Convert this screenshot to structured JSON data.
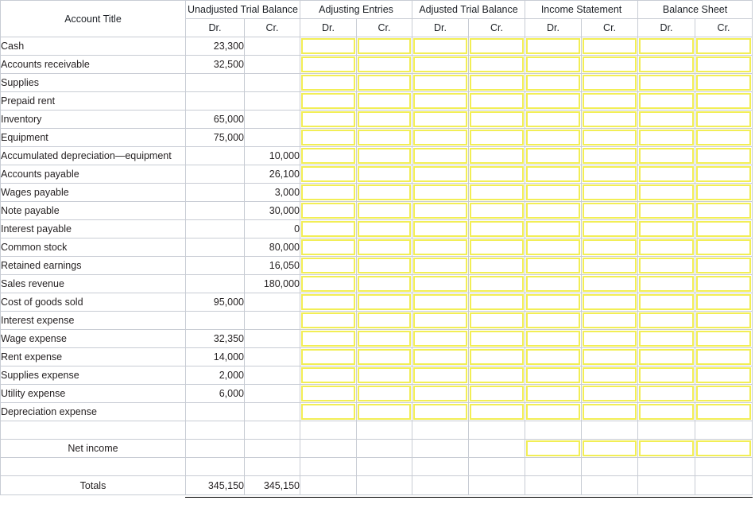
{
  "table": {
    "title_column_header": "Account Title",
    "column_groups": [
      {
        "label": "Unadjusted Trial Balance",
        "sub": [
          "Dr.",
          "Cr."
        ]
      },
      {
        "label": "Adjusting Entries",
        "sub": [
          "Dr.",
          "Cr."
        ]
      },
      {
        "label": "Adjusted Trial Balance",
        "sub": [
          "Dr.",
          "Cr."
        ]
      },
      {
        "label": "Income Statement",
        "sub": [
          "Dr.",
          "Cr."
        ]
      },
      {
        "label": "Balance Sheet",
        "sub": [
          "Dr.",
          "Cr."
        ]
      }
    ],
    "sub_headers": [
      "Dr.",
      "Cr.",
      "Dr.",
      "Cr.",
      "Dr.",
      "Cr.",
      "Dr.",
      "Cr.",
      "Dr.",
      "Cr."
    ],
    "rows": [
      {
        "account": "Cash",
        "utb_dr": "23,300",
        "utb_cr": ""
      },
      {
        "account": "Accounts receivable",
        "utb_dr": "32,500",
        "utb_cr": ""
      },
      {
        "account": "Supplies",
        "utb_dr": "",
        "utb_cr": ""
      },
      {
        "account": "Prepaid rent",
        "utb_dr": "",
        "utb_cr": ""
      },
      {
        "account": "Inventory",
        "utb_dr": "65,000",
        "utb_cr": ""
      },
      {
        "account": "Equipment",
        "utb_dr": "75,000",
        "utb_cr": ""
      },
      {
        "account": "Accumulated depreciation—equipment",
        "utb_dr": "",
        "utb_cr": "10,000"
      },
      {
        "account": "Accounts payable",
        "utb_dr": "",
        "utb_cr": "26,100"
      },
      {
        "account": "Wages payable",
        "utb_dr": "",
        "utb_cr": "3,000"
      },
      {
        "account": "Note payable",
        "utb_dr": "",
        "utb_cr": "30,000"
      },
      {
        "account": "Interest payable",
        "utb_dr": "",
        "utb_cr": "0"
      },
      {
        "account": "Common stock",
        "utb_dr": "",
        "utb_cr": "80,000"
      },
      {
        "account": "Retained earnings",
        "utb_dr": "",
        "utb_cr": "16,050"
      },
      {
        "account": "Sales revenue",
        "utb_dr": "",
        "utb_cr": "180,000"
      },
      {
        "account": "Cost of goods sold",
        "utb_dr": "95,000",
        "utb_cr": ""
      },
      {
        "account": "Interest expense",
        "utb_dr": "",
        "utb_cr": ""
      },
      {
        "account": "Wage expense",
        "utb_dr": "32,350",
        "utb_cr": ""
      },
      {
        "account": "Rent expense",
        "utb_dr": "14,000",
        "utb_cr": ""
      },
      {
        "account": "Supplies expense",
        "utb_dr": "2,000",
        "utb_cr": ""
      },
      {
        "account": "Utility expense",
        "utb_dr": "6,000",
        "utb_cr": ""
      },
      {
        "account": "Depreciation expense",
        "utb_dr": "",
        "utb_cr": ""
      }
    ],
    "net_income_row": {
      "account": "Net income"
    },
    "totals_row": {
      "account": "Totals",
      "utb_dr": "345,150",
      "utb_cr": "345,150"
    }
  },
  "colors": {
    "header_background": "#85a2d0",
    "input_border": "#f2ee55",
    "grid_line": "#c8ccd4",
    "rule": "#000000",
    "text": "#231f20"
  }
}
